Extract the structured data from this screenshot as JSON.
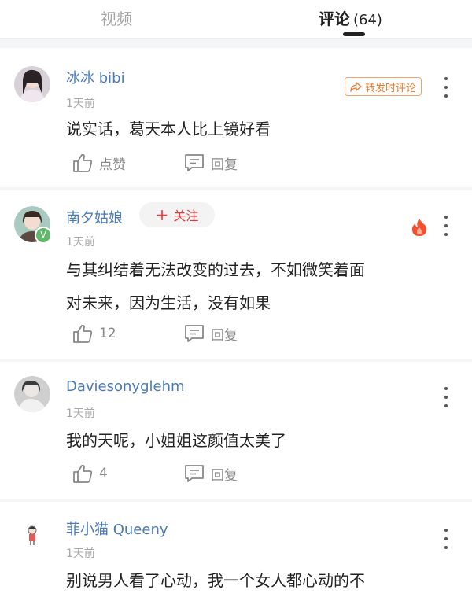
{
  "tabs": {
    "video": "视频",
    "comments": "评论",
    "comments_count": "(64)"
  },
  "comments": [
    {
      "username": "冰冰 bibi",
      "time": "1天前",
      "text_lines": [
        "说实话，葛天本人比上镜好看"
      ],
      "like_label": "点赞",
      "reply_label": "回复",
      "forward_label": "转发时评论"
    },
    {
      "username": "南夕姑娘",
      "follow_label": "关注",
      "verified_badge": "V",
      "time": "1天前",
      "text_lines": [
        "与其纠结着无法改变的过去，不如微笑着面",
        "对未来，因为生活，没有如果"
      ],
      "like_label": "12",
      "reply_label": "回复",
      "hot_icon": "flame-icon"
    },
    {
      "username": "Daviesonyglehm",
      "time": "1天前",
      "text_lines": [
        "我的天呢，小姐姐这颜值太美了"
      ],
      "like_label": "4",
      "reply_label": "回复"
    },
    {
      "username": "菲小猫 Queeny",
      "time": "1天前",
      "text_lines": [
        "别说男人看了心动，我一个女人都心动的不"
      ]
    }
  ],
  "colors": {
    "username": "#4a7ab8",
    "follow": "#e2393b",
    "forward": "#e47a2e",
    "hot": "#f0512f"
  }
}
